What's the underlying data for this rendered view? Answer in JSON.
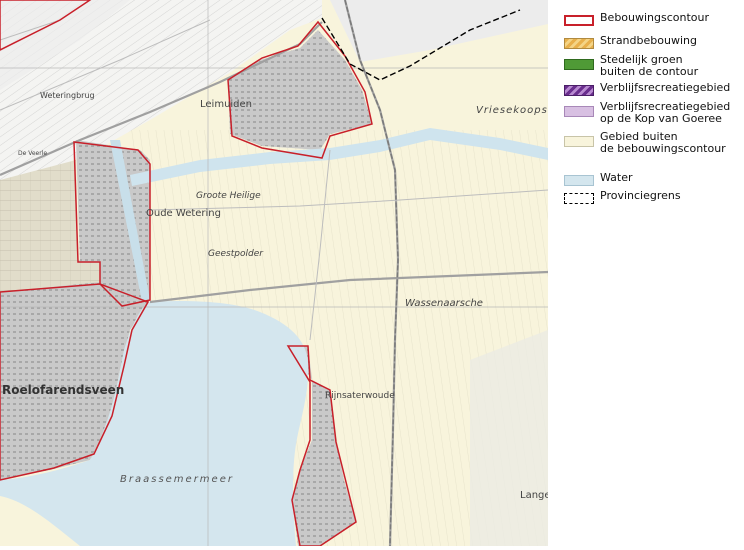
{
  "map": {
    "places": {
      "leimuiden": "Leimuiden",
      "oude_wetering": "Oude Wetering",
      "roelofarendsveen": "Roelofarendsveen",
      "rijnsaterwoude": "Rijnsaterwoude",
      "langeraar": "Lange",
      "braassemermeer": "Braassemermeer",
      "groote_heilige": "Groote Heilige",
      "geestpolder": "Geestpolder",
      "wassenaarsche": "Wassenaarsche",
      "vrieschepolder": "Vriesekoops",
      "weteringbrug": "Weteringbrug",
      "de_veerle": "De Veerle"
    },
    "colors": {
      "land": "#f8f4dc",
      "water": "#d4e6ee",
      "urban": "#c6c6c6",
      "greenhouse": "#d8d4c4",
      "contour": "#c8202a",
      "infrastructure": "#9a9a9a"
    }
  },
  "legend": {
    "items": [
      {
        "label": "Bebouwingscontour",
        "swatch": "contour-red"
      },
      {
        "label": "Strandbebouwing",
        "swatch": "orange-hatch"
      },
      {
        "label": "Stedelijk groen\nbuiten de contour",
        "swatch": "green"
      },
      {
        "label": "Verblijfsrecreatiegebied",
        "swatch": "purple-hatch"
      },
      {
        "label": "Verblijfsrecreatiegebied\nop de Kop van Goeree",
        "swatch": "light-purple"
      },
      {
        "label": "Gebied buiten\nde bebouwingscontour",
        "swatch": "pale-yellow"
      },
      {
        "label": "Water",
        "swatch": "light-blue"
      },
      {
        "label": "Provinciegrens",
        "swatch": "dashed-black"
      }
    ]
  }
}
